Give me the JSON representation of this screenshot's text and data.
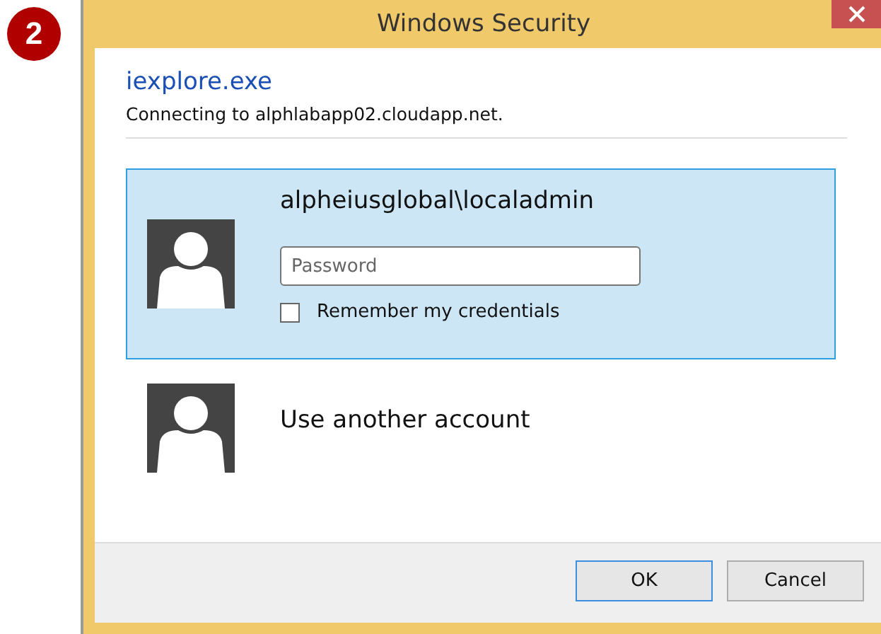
{
  "step_badge": "2",
  "window": {
    "title": "Windows Security"
  },
  "app_name": "iexplore.exe",
  "message": "Connecting to alphlabapp02.cloudapp.net.",
  "accounts": [
    {
      "kind": "credential",
      "name": "alpheiusglobal\\localadmin",
      "selected": true,
      "password": {
        "placeholder": "Password"
      },
      "remember": {
        "label": "Remember my credentials",
        "checked": false
      }
    },
    {
      "kind": "other",
      "name": "Use another account",
      "selected": false
    }
  ],
  "buttons": [
    {
      "label": "OK",
      "default": true
    },
    {
      "label": "Cancel",
      "default": false
    }
  ]
}
